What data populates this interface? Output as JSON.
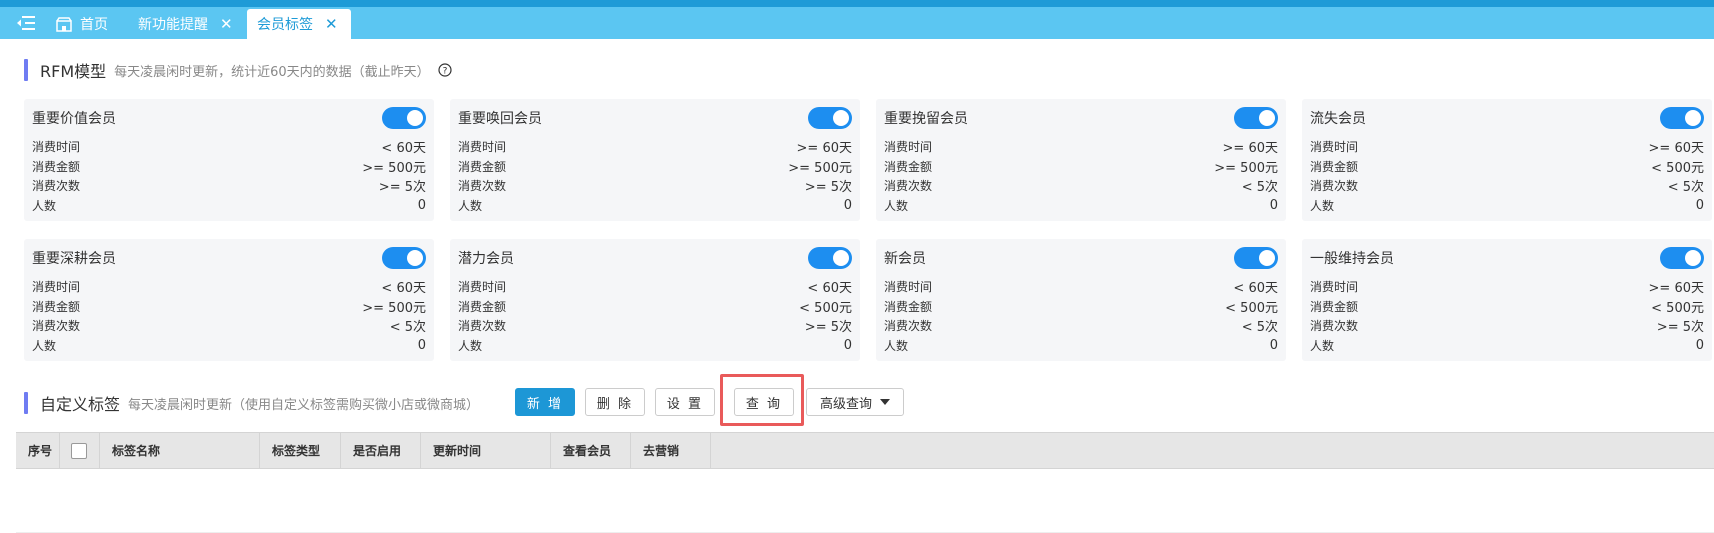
{
  "tabs": [
    {
      "label": "首页",
      "closable": false,
      "active": false
    },
    {
      "label": "新功能提醒",
      "closable": true,
      "active": false
    },
    {
      "label": "会员标签",
      "closable": true,
      "active": true
    }
  ],
  "rfm": {
    "title": "RFM模型",
    "desc": "每天凌晨闲时更新，统计近60天内的数据（截止昨天）",
    "cards": [
      {
        "title": "重要价值会员",
        "enabled": true,
        "rows": [
          {
            "k": "消费时间",
            "v": "< 60天"
          },
          {
            "k": "消费金额",
            "v": ">= 500元"
          },
          {
            "k": "消费次数",
            "v": ">= 5次"
          },
          {
            "k": "人数",
            "v": "0"
          }
        ]
      },
      {
        "title": "重要唤回会员",
        "enabled": true,
        "rows": [
          {
            "k": "消费时间",
            "v": ">= 60天"
          },
          {
            "k": "消费金额",
            "v": ">= 500元"
          },
          {
            "k": "消费次数",
            "v": ">= 5次"
          },
          {
            "k": "人数",
            "v": "0"
          }
        ]
      },
      {
        "title": "重要挽留会员",
        "enabled": true,
        "rows": [
          {
            "k": "消费时间",
            "v": ">= 60天"
          },
          {
            "k": "消费金额",
            "v": ">= 500元"
          },
          {
            "k": "消费次数",
            "v": "< 5次"
          },
          {
            "k": "人数",
            "v": "0"
          }
        ]
      },
      {
        "title": "流失会员",
        "enabled": true,
        "rows": [
          {
            "k": "消费时间",
            "v": ">= 60天"
          },
          {
            "k": "消费金额",
            "v": "< 500元"
          },
          {
            "k": "消费次数",
            "v": "< 5次"
          },
          {
            "k": "人数",
            "v": "0"
          }
        ]
      },
      {
        "title": "重要深耕会员",
        "enabled": true,
        "rows": [
          {
            "k": "消费时间",
            "v": "< 60天"
          },
          {
            "k": "消费金额",
            "v": ">= 500元"
          },
          {
            "k": "消费次数",
            "v": "< 5次"
          },
          {
            "k": "人数",
            "v": "0"
          }
        ]
      },
      {
        "title": "潜力会员",
        "enabled": true,
        "rows": [
          {
            "k": "消费时间",
            "v": "< 60天"
          },
          {
            "k": "消费金额",
            "v": "< 500元"
          },
          {
            "k": "消费次数",
            "v": ">= 5次"
          },
          {
            "k": "人数",
            "v": "0"
          }
        ]
      },
      {
        "title": "新会员",
        "enabled": true,
        "rows": [
          {
            "k": "消费时间",
            "v": "< 60天"
          },
          {
            "k": "消费金额",
            "v": "< 500元"
          },
          {
            "k": "消费次数",
            "v": "< 5次"
          },
          {
            "k": "人数",
            "v": "0"
          }
        ]
      },
      {
        "title": "一般维持会员",
        "enabled": true,
        "rows": [
          {
            "k": "消费时间",
            "v": ">= 60天"
          },
          {
            "k": "消费金额",
            "v": "< 500元"
          },
          {
            "k": "消费次数",
            "v": ">= 5次"
          },
          {
            "k": "人数",
            "v": "0"
          }
        ]
      }
    ]
  },
  "custom": {
    "title": "自定义标签",
    "desc": "每天凌晨闲时更新（使用自定义标签需购买微小店或微商城）",
    "buttons": {
      "add": "新 增",
      "delete": "删 除",
      "settings": "设 置",
      "query": "查 询",
      "advanced": "高级查询"
    }
  },
  "table": {
    "columns": [
      "序号",
      "",
      "标签名称",
      "标签类型",
      "是否启用",
      "更新时间",
      "查看会员",
      "去营销"
    ]
  },
  "colors": {
    "accent": "#1d97d6",
    "tabbar": "#5bc6f2",
    "toggle": "#1d8ef0",
    "highlight": "#e95a5a"
  }
}
